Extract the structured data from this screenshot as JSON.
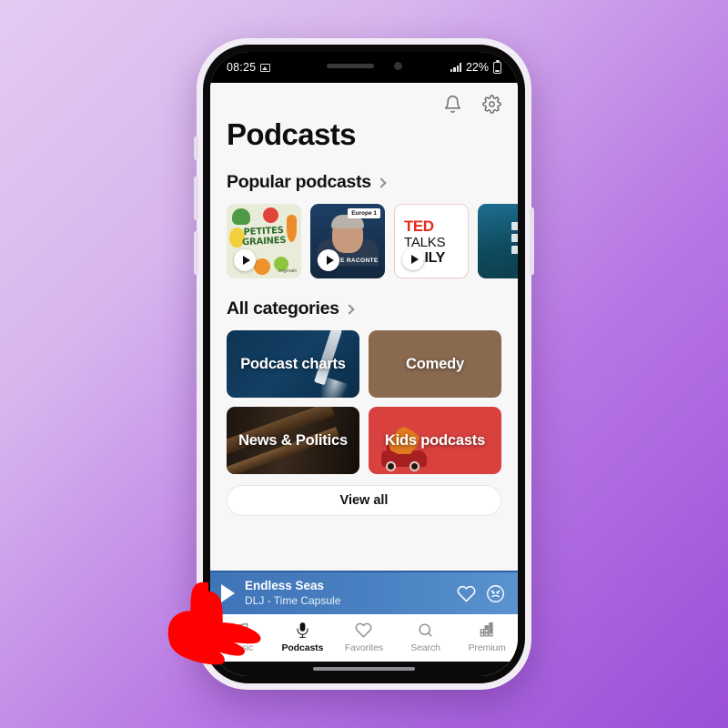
{
  "statusbar": {
    "time": "08:25",
    "image_icon": "image-icon",
    "battery_percent": "22%",
    "signal_icon": "signal-bars-icon",
    "battery_icon": "battery-icon"
  },
  "header": {
    "title": "Podcasts",
    "bell_icon": "bell-icon",
    "gear_icon": "gear-icon"
  },
  "sections": {
    "popular": {
      "title": "Popular podcasts",
      "chevron_icon": "chevron-right-icon"
    },
    "categories": {
      "title": "All categories",
      "chevron_icon": "chevron-right-icon"
    }
  },
  "popular_cards": [
    {
      "name": "petites-graines",
      "line1": "PETITES",
      "line2": "GRAINES",
      "footer": "originals",
      "play_icon": "play-icon"
    },
    {
      "name": "europe1-raconte",
      "badge": "Europe 1",
      "title": "H...OTTE RACONTE",
      "play_icon": "play-icon"
    },
    {
      "name": "ted-talks-daily",
      "word1": "TED",
      "word2": "TALKS",
      "word3": "DAILY",
      "play_icon": "play-icon"
    },
    {
      "name": "teal-podcast",
      "title": ""
    }
  ],
  "category_tiles": [
    {
      "name": "podcast-charts",
      "label": "Podcast charts",
      "color": "#0e3555"
    },
    {
      "name": "comedy",
      "label": "Comedy",
      "color": "#8a6a4f"
    },
    {
      "name": "news-politics",
      "label": "News & Politics",
      "color": "#1b1410"
    },
    {
      "name": "kids-podcasts",
      "label": "Kids podcasts",
      "color": "#d9413f"
    }
  ],
  "view_all": {
    "label": "View all"
  },
  "now_playing": {
    "title": "Endless Seas",
    "subtitle": "DLJ - Time Capsule",
    "play_icon": "play-icon",
    "heart_icon": "heart-outline-icon",
    "dislike_icon": "angry-face-icon",
    "background_color": "#4a81c2"
  },
  "bottom_nav": [
    {
      "name": "music",
      "label": "Music",
      "icon": "music-note-icon",
      "active": false
    },
    {
      "name": "podcasts",
      "label": "Podcasts",
      "icon": "microphone-icon",
      "active": true
    },
    {
      "name": "favorites",
      "label": "Favorites",
      "icon": "heart-outline-icon",
      "active": false
    },
    {
      "name": "search",
      "label": "Search",
      "icon": "magnifier-icon",
      "active": false
    },
    {
      "name": "premium",
      "label": "Premium",
      "icon": "equalizer-icon",
      "active": false
    }
  ],
  "cursor": {
    "name": "hand-pointer-cursor",
    "color": "#ff0000"
  },
  "theme": {
    "background_start": "#e3cbf2",
    "background_end": "#9a4fd8",
    "accent": "#4a81c2"
  }
}
